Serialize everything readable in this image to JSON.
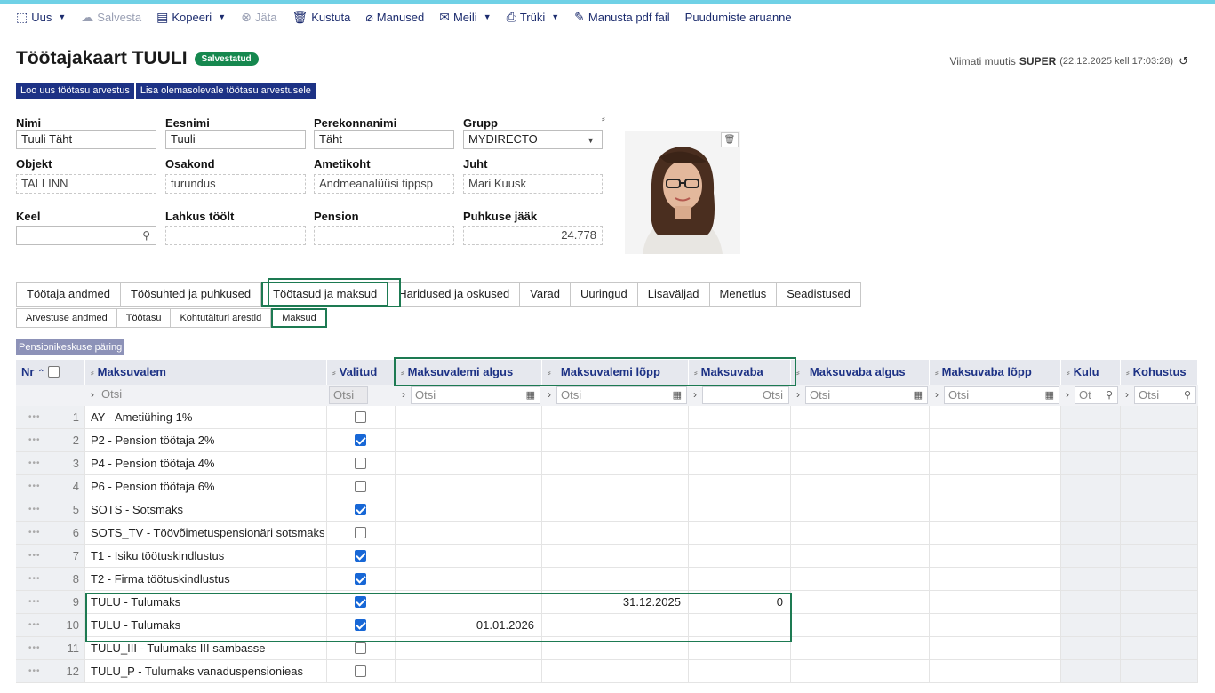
{
  "toolbar": {
    "new": "Uus",
    "save": "Salvesta",
    "copy": "Kopeeri",
    "cancel": "Jäta",
    "delete": "Kustuta",
    "attachments": "Manused",
    "mail": "Meili",
    "print": "Trüki",
    "attach_pdf": "Manusta pdf fail",
    "absence_report": "Puudumiste aruanne"
  },
  "header": {
    "title": "Töötajakaart TUULI",
    "status_badge": "Salvestatud",
    "last_modified_prefix": "Viimati muutis",
    "last_modified_user": "SUPER",
    "last_modified_time": "(22.12.2025 kell 17:03:28)"
  },
  "actions": {
    "new_payroll": "Loo uus töötasu arvestus",
    "add_to_payroll": "Lisa olemasolevale töötasu arvestusele"
  },
  "form": {
    "name_label": "Nimi",
    "name": "Tuuli Täht",
    "firstname_label": "Eesnimi",
    "firstname": "Tuuli",
    "lastname_label": "Perekonnanimi",
    "lastname": "Täht",
    "group_label": "Grupp",
    "group": "MYDIRECTO",
    "object_label": "Objekt",
    "object": "TALLINN",
    "department_label": "Osakond",
    "department": "turundus",
    "position_label": "Ametikoht",
    "position": "Andmeanalüüsi tippsp",
    "manager_label": "Juht",
    "manager": "Mari Kuusk",
    "language_label": "Keel",
    "language": "",
    "leaving_label": "Lahkus töölt",
    "leaving": "",
    "pension_label": "Pension",
    "pension": "",
    "vacation_label": "Puhkuse jääk",
    "vacation": "24.778"
  },
  "tabs": [
    "Töötaja andmed",
    "Töösuhted ja puhkused",
    "Töötasud ja maksud",
    "Haridused ja oskused",
    "Varad",
    "Uuringud",
    "Lisaväljad",
    "Menetlus",
    "Seadistused"
  ],
  "subtabs": [
    "Arvestuse andmed",
    "Töötasu",
    "Kohtutäituri arestid",
    "Maksud"
  ],
  "pension_query": "Pensionikeskuse päring",
  "grid": {
    "columns": {
      "nr": "Nr",
      "formula": "Maksuvalem",
      "selected": "Valitud",
      "formula_start": "Maksuvalemi algus",
      "formula_end": "Maksuvalemi lõpp",
      "tax_free": "Maksuvaba",
      "tax_free_start": "Maksuvaba algus",
      "tax_free_end": "Maksuvaba lõpp",
      "expense": "Kulu",
      "liability": "Kohustus"
    },
    "filter_placeholder": "Otsi",
    "filter_short": "Ot",
    "rows": [
      {
        "nr": "1",
        "formula": "AY - Ametiühing 1%",
        "selected": false,
        "start": "",
        "end": "",
        "taxfree": ""
      },
      {
        "nr": "2",
        "formula": "P2 - Pension töötaja 2%",
        "selected": true,
        "start": "",
        "end": "",
        "taxfree": ""
      },
      {
        "nr": "3",
        "formula": "P4 - Pension töötaja 4%",
        "selected": false,
        "start": "",
        "end": "",
        "taxfree": ""
      },
      {
        "nr": "4",
        "formula": "P6 - Pension töötaja 6%",
        "selected": false,
        "start": "",
        "end": "",
        "taxfree": ""
      },
      {
        "nr": "5",
        "formula": "SOTS - Sotsmaks",
        "selected": true,
        "start": "",
        "end": "",
        "taxfree": ""
      },
      {
        "nr": "6",
        "formula": "SOTS_TV - Töövõimetuspensionäri sotsmaks",
        "selected": false,
        "start": "",
        "end": "",
        "taxfree": ""
      },
      {
        "nr": "7",
        "formula": "T1 - Isiku töötuskindlustus",
        "selected": true,
        "start": "",
        "end": "",
        "taxfree": ""
      },
      {
        "nr": "8",
        "formula": "T2 - Firma töötuskindlustus",
        "selected": true,
        "start": "",
        "end": "",
        "taxfree": ""
      },
      {
        "nr": "9",
        "formula": "TULU - Tulumaks",
        "selected": true,
        "start": "",
        "end": "31.12.2025",
        "taxfree": "0"
      },
      {
        "nr": "10",
        "formula": "TULU - Tulumaks",
        "selected": true,
        "start": "01.01.2026",
        "end": "",
        "taxfree": ""
      },
      {
        "nr": "11",
        "formula": "TULU_III - Tulumaks III sambasse",
        "selected": false,
        "start": "",
        "end": "",
        "taxfree": ""
      },
      {
        "nr": "12",
        "formula": "TULU_P - Tulumaks vanaduspensionieas",
        "selected": false,
        "start": "",
        "end": "",
        "taxfree": ""
      }
    ]
  },
  "colors": {
    "primary": "#1d3285",
    "highlight": "#1d7a52",
    "badge": "#16884f",
    "checkbox": "#1767d6",
    "accent_top": "#6fd1e6"
  }
}
